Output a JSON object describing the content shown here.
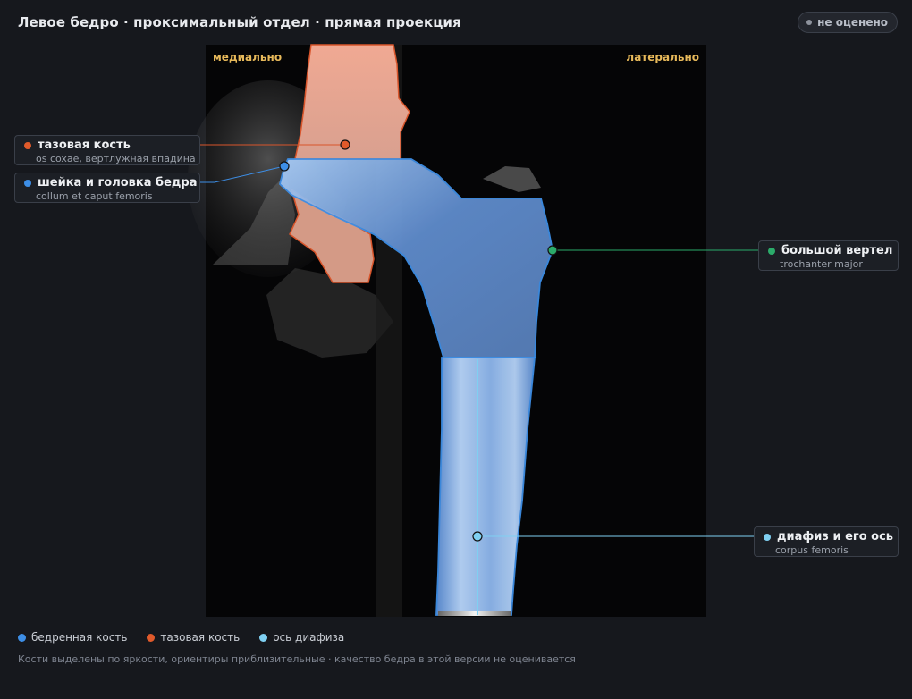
{
  "header": {
    "title": "Левое бедро · проксимальный отдел · прямая проекция",
    "status_badge": "не оценено"
  },
  "viewer": {
    "orientation_left": "медиально",
    "orientation_right": "латерально"
  },
  "labels": [
    {
      "name": "тазовая кость",
      "latin": "os coxae, вертлужная впадина",
      "color": "#e05a2b"
    },
    {
      "name": "шейка и головка бедра",
      "latin": "collum et caput femoris",
      "color": "#3d8ee6"
    },
    {
      "name": "большой вертел",
      "latin": "trochanter major",
      "color": "#2bab6a"
    },
    {
      "name": "диафиз и его ось",
      "latin": "corpus femoris",
      "color": "#7fd0f2"
    }
  ],
  "legend": [
    {
      "label": "бедренная кость",
      "color": "#3d8ee6"
    },
    {
      "label": "тазовая кость",
      "color": "#e05a2b"
    },
    {
      "label": "ось диафиза",
      "color": "#7fd0f2"
    }
  ],
  "footnote": "Кости выделены по яркости, ориентиры приблизительные · качество бедра в этой версии не оценивается",
  "colors": {
    "femur_fill": "#6f9fe0",
    "femur_outline": "#3d8ee6",
    "pelvis_fill": "#f3b09a",
    "pelvis_outline": "#d9552b",
    "axis": "#7fd0f2",
    "orientation_text": "#e7b95a"
  }
}
